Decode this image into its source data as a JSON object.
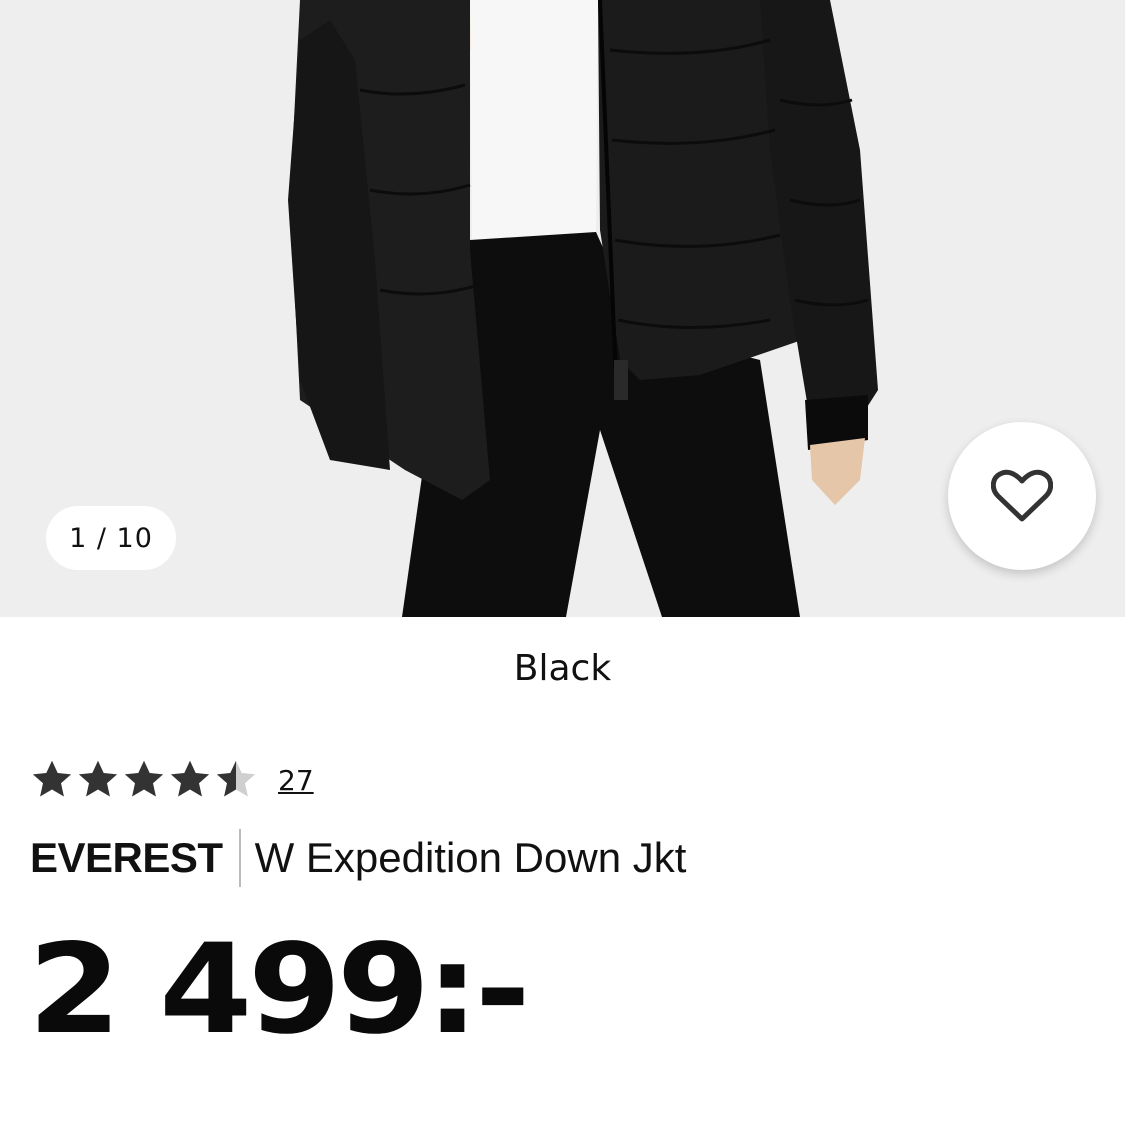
{
  "gallery": {
    "counter": "1 / 10",
    "favorite_icon": "heart-outline-icon"
  },
  "product": {
    "color": "Black",
    "rating": {
      "value": 4.5,
      "max": 5,
      "count": "27",
      "filled_color": "#333333",
      "empty_color": "#cfcfcf"
    },
    "brand": "EVEREST",
    "name": "W Expedition Down Jkt",
    "price": "2 499:-"
  }
}
